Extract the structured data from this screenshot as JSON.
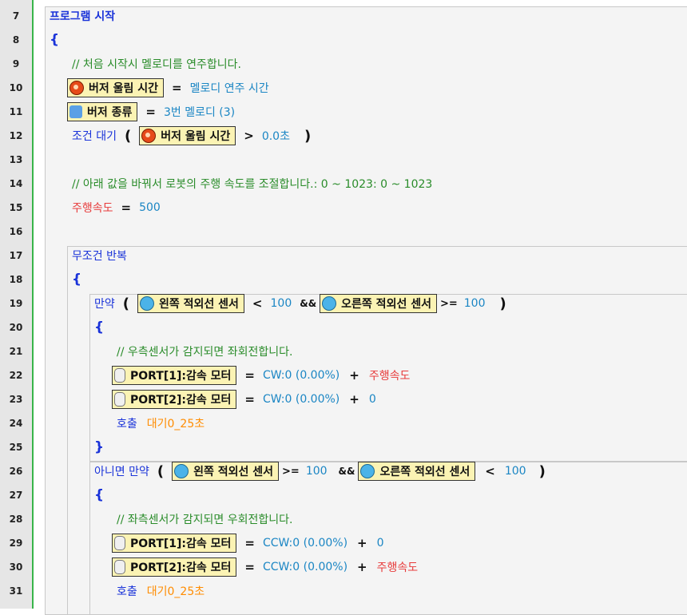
{
  "lines": [
    "7",
    "8",
    "9",
    "10",
    "11",
    "12",
    "13",
    "14",
    "15",
    "16",
    "17",
    "18",
    "19",
    "20",
    "21",
    "22",
    "23",
    "24",
    "25",
    "26",
    "27",
    "28",
    "29",
    "30",
    "31"
  ],
  "program_start": "프로그램 시작",
  "brace_open": "{",
  "brace_close": "}",
  "comment1": "//  처음 시작시 멜로디를 연주합니다.",
  "buzzer_time": "버저 울림 시간",
  "melody_time": "멜로디 연주 시간",
  "buzzer_type": "버저 종류",
  "melody3": "3번 멜로디 (3)",
  "wait_cond": "조건 대기",
  "val_00s": "0.0초",
  "comment2": "//  아래 값을 바꿔서 로봇의 주행 속도를 조절합니다.: 0 ~ 1023: 0 ~ 1023",
  "speed_var": "주행속도",
  "val_500": "500",
  "loop_forever": "무조건 반복",
  "if_kw": "만약",
  "else_if_kw": "아니면 만약",
  "left_ir": "왼쪽 적외선 센서",
  "right_ir": "오른쪽 적외선 센서",
  "val_100": "100",
  "comment3": "//  우측센서가 감지되면 좌회전합니다.",
  "comment4": "//  좌측센서가 감지되면 우회전합니다.",
  "port1": "PORT[1]:감속 모터",
  "port2": "PORT[2]:감속 모터",
  "cw": "CW:0 (0.00%)",
  "ccw": "CCW:0 (0.00%)",
  "val_0": "0",
  "call_kw": "호출",
  "wait_func": "대기0_25초",
  "ops": {
    "eq": "=",
    "gt": ">",
    "lt": "<",
    "ge": ">=",
    "and": "&&",
    "plus": "+",
    "lparen": "(",
    "rparen": ")"
  },
  "icons": [
    "timer-icon",
    "music-icon",
    "ir-sensor-icon",
    "motor-icon"
  ]
}
